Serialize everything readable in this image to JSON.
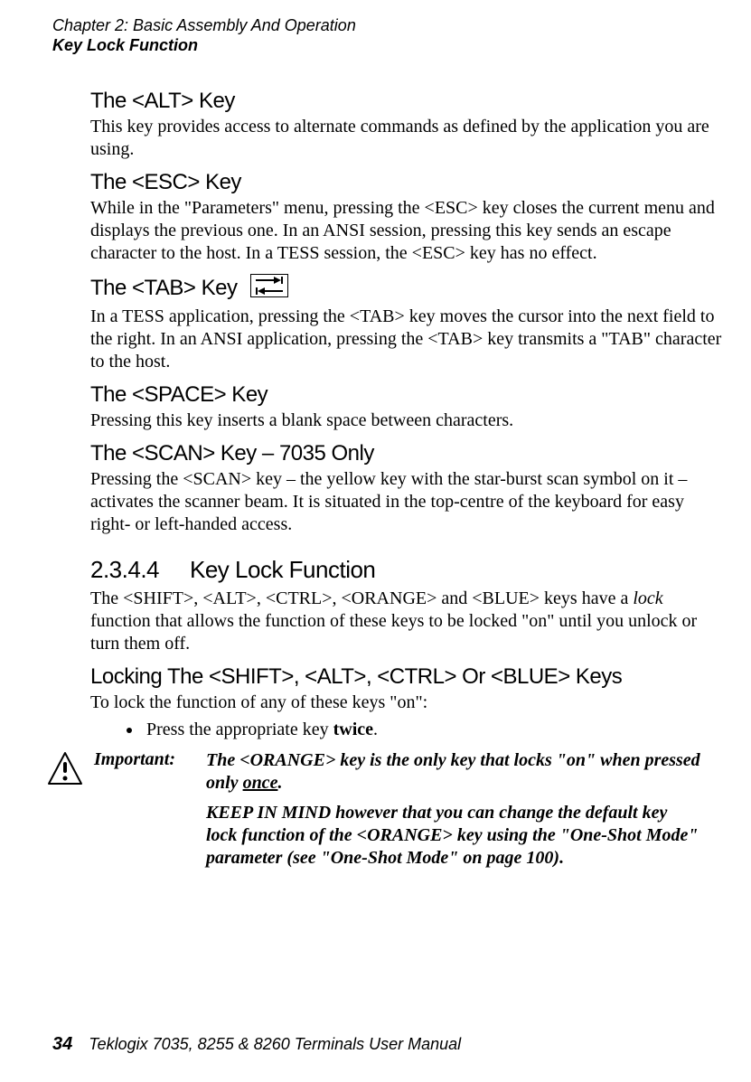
{
  "header": {
    "chapter": "Chapter 2: Basic Assembly And Operation",
    "section": "Key Lock Function"
  },
  "sections": {
    "alt": {
      "title": "The <ALT> Key",
      "body": "This key provides access to alternate commands as defined by the application you are using."
    },
    "esc": {
      "title": "The <ESC> Key",
      "body": "While in the \"Parameters\" menu, pressing the <ESC> key closes the current menu and displays the previous one. In an ANSI session, pressing this key sends an escape character to the host. In a TESS session, the <ESC> key has no effect."
    },
    "tab": {
      "title": "The <TAB> Key",
      "body": "In a TESS application, pressing the <TAB> key moves the cursor into the next field to the right. In an ANSI application, pressing the <TAB> key transmits a \"TAB\" character to the host."
    },
    "space": {
      "title": "The <SPACE> Key",
      "body": "Pressing this key inserts a blank space between characters."
    },
    "scan": {
      "title": "The <SCAN> Key – 7035 Only",
      "body": "Pressing the <SCAN> key – the yellow key with the star-burst scan symbol on it – activates the scanner beam. It is situated in the top-centre of the keyboard for easy right- or left-handed access."
    },
    "keylock": {
      "number": "2.3.4.4",
      "title": "Key Lock Function",
      "body_pre": "The <SHIFT>, <ALT>, <CTRL>, <ORANGE> and <BLUE> keys have a ",
      "body_italic": "lock",
      "body_post": " function that allows the function of these keys to be locked \"on\" until you unlock or turn them off."
    },
    "locking": {
      "title": "Locking The <SHIFT>, <ALT>, <CTRL> Or <BLUE> Keys",
      "body": "To lock the function of any of these keys \"on\":",
      "bullet_pre": "Press the appropriate key ",
      "bullet_bold": "twice",
      "bullet_post": "."
    },
    "important": {
      "label": "Important:",
      "line1_pre": "The <ORANGE> key is the only key that locks \"on\" when pressed only ",
      "line1_under": "once",
      "line1_post": ".",
      "line2": "KEEP IN MIND however that you can change the default key lock function of the <ORANGE> key using the \"One-Shot Mode\" parameter (see \"One-Shot Mode\" on page 100)."
    }
  },
  "footer": {
    "page": "34",
    "manual": "Teklogix 7035, 8255 & 8260 Terminals User Manual"
  }
}
